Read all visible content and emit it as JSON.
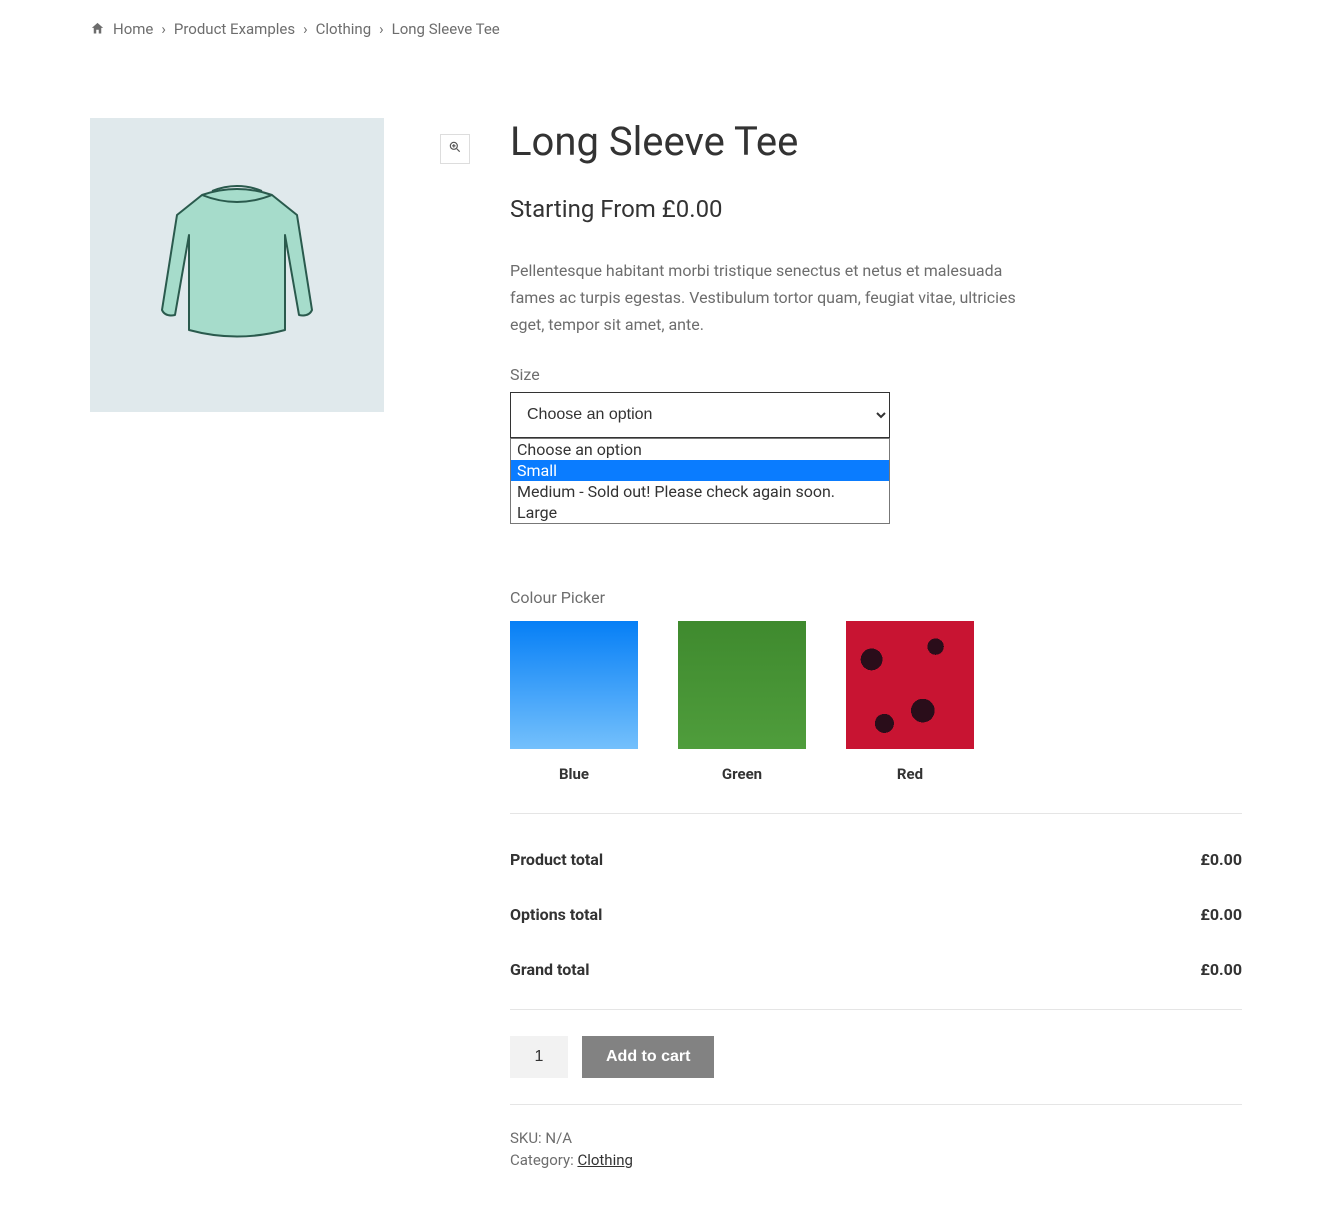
{
  "breadcrumb": {
    "home": "Home",
    "examples": "Product Examples",
    "clothing": "Clothing",
    "current": "Long Sleeve Tee"
  },
  "product": {
    "title": "Long Sleeve Tee",
    "price_prefix": "Starting From ",
    "price": "£0.00",
    "description": "Pellentesque habitant morbi tristique senectus et netus et malesuada fames ac turpis egestas. Vestibulum tortor quam, feugiat vitae, ultricies eget, tempor sit amet, ante."
  },
  "size": {
    "label": "Size",
    "selected": "Choose an option",
    "options": {
      "opt0": "Choose an option",
      "opt1": "Small",
      "opt2": "Medium - Sold out! Please check again soon.",
      "opt3": "Large"
    }
  },
  "color": {
    "label": "Colour Picker",
    "swatches": {
      "blue": "Blue",
      "green": "Green",
      "red": "Red"
    }
  },
  "totals": {
    "product_label": "Product total",
    "product_value": "£0.00",
    "options_label": "Options total",
    "options_value": "£0.00",
    "grand_label": "Grand total",
    "grand_value": "£0.00"
  },
  "cart": {
    "qty": "1",
    "button": "Add to cart"
  },
  "meta": {
    "sku_label": "SKU: ",
    "sku_value": "N/A",
    "cat_label": "Category: ",
    "cat_value": "Clothing"
  }
}
